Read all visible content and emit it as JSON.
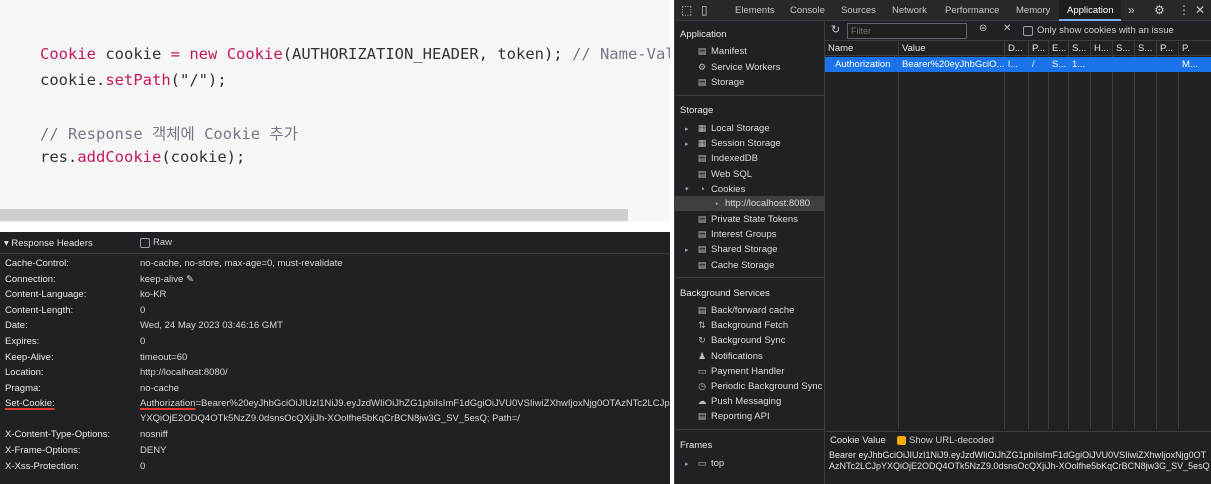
{
  "code": {
    "line1": [
      {
        "t": "Cookie",
        "c": "kw"
      },
      {
        "t": " cookie ",
        "c": ""
      },
      {
        "t": "=",
        "c": "kw"
      },
      {
        "t": " ",
        "c": ""
      },
      {
        "t": "new",
        "c": "kw"
      },
      {
        "t": " ",
        "c": ""
      },
      {
        "t": "Cookie",
        "c": "kw"
      },
      {
        "t": "(AUTHORIZATION_HEADER, token); ",
        "c": ""
      },
      {
        "t": "// Name-Val",
        "c": "cm"
      }
    ],
    "line2": [
      {
        "t": "cookie.",
        "c": ""
      },
      {
        "t": "setPath",
        "c": "kw"
      },
      {
        "t": "(\"/\");",
        "c": ""
      }
    ],
    "line3": [
      {
        "t": "// Response 객체에 Cookie 추가",
        "c": "cm"
      }
    ],
    "line4": [
      {
        "t": "res.",
        "c": ""
      },
      {
        "t": "addCookie",
        "c": "kw"
      },
      {
        "t": "(cookie);",
        "c": ""
      }
    ]
  },
  "response_headers": {
    "title": "▾ Response Headers",
    "raw_label": "Raw",
    "rows": [
      {
        "name": "Cache-Control:",
        "value": "no-cache, no-store, max-age=0, must-revalidate"
      },
      {
        "name": "Connection:",
        "value": "keep-alive ✎"
      },
      {
        "name": "Content-Language:",
        "value": "ko-KR"
      },
      {
        "name": "Content-Length:",
        "value": "0"
      },
      {
        "name": "Date:",
        "value": "Wed, 24 May 2023 03:46:16 GMT"
      },
      {
        "name": "Expires:",
        "value": "0"
      },
      {
        "name": "Keep-Alive:",
        "value": "timeout=60"
      },
      {
        "name": "Location:",
        "value": "http://localhost:8080/"
      },
      {
        "name": "Pragma:",
        "value": "no-cache"
      }
    ],
    "set_cookie": {
      "name": "Set-Cookie:",
      "value_key": "Authorization",
      "value_line1": "=Bearer%20eyJhbGciOiJIUzI1NiJ9.eyJzdWIiOiJhZG1pbiIsImF1dGgiOiJVU0VSIiwiZXhwIjoxNjg0OTAzNTc2LCJp",
      "value_line2": "YXQiOjE2ODQ4OTk5NzZ9.0dsnsOcQXjiJh-XOolfhe5bKqCrBCN8jw3G_SV_5esQ; Path=/"
    },
    "rows_after": [
      {
        "name": "X-Content-Type-Options:",
        "value": "nosniff"
      },
      {
        "name": "X-Frame-Options:",
        "value": "DENY"
      },
      {
        "name": "X-Xss-Protection:",
        "value": "0"
      }
    ]
  },
  "devtools": {
    "tabs": [
      "Elements",
      "Console",
      "Sources",
      "Network",
      "Performance",
      "Memory",
      "Application"
    ],
    "active_tab": "Application",
    "more_tabs": "»",
    "sidebar": {
      "application_title": "Application",
      "application_items": [
        "Manifest",
        "Service Workers",
        "Storage"
      ],
      "storage_title": "Storage",
      "storage_items": [
        "Local Storage",
        "Session Storage",
        "IndexedDB",
        "Web SQL",
        "Cookies"
      ],
      "cookie_origin": "http://localhost:8080",
      "storage_items_after": [
        "Private State Tokens",
        "Interest Groups",
        "Shared Storage",
        "Cache Storage"
      ],
      "bg_title": "Background Services",
      "bg_items": [
        "Back/forward cache",
        "Background Fetch",
        "Background Sync",
        "Notifications",
        "Payment Handler",
        "Periodic Background Sync",
        "Push Messaging",
        "Reporting API"
      ],
      "frames_title": "Frames",
      "frames_item": "top"
    },
    "filter_placeholder": "Filter",
    "only_issue_label": "Only show cookies with an issue",
    "columns": [
      "Name",
      "Value",
      "D...",
      "P...",
      "E...",
      "S...",
      "H...",
      "S...",
      "S...",
      "P...",
      "P."
    ],
    "row": [
      "Authorization",
      "Bearer%20eyJhbGciO...",
      "l...",
      "/",
      "S...",
      "1...",
      "",
      "",
      "",
      "",
      "M..."
    ],
    "cookie_value_title": "Cookie Value",
    "show_url_decoded": "Show URL-decoded",
    "cookie_value": "Bearer eyJhbGciOiJIUzI1NiJ9.eyJzdWIiOiJhZG1pbiIsImF1dGgiOiJVU0VSIiwiZXhwIjoxNjg0OTAzNTc2LCJpYXQiOjE2ODQ4OTk5NzZ9.0dsnsOcQXjiJh-XOolfhe5bKqCrBCN8jw3G_SV_5esQ"
  }
}
